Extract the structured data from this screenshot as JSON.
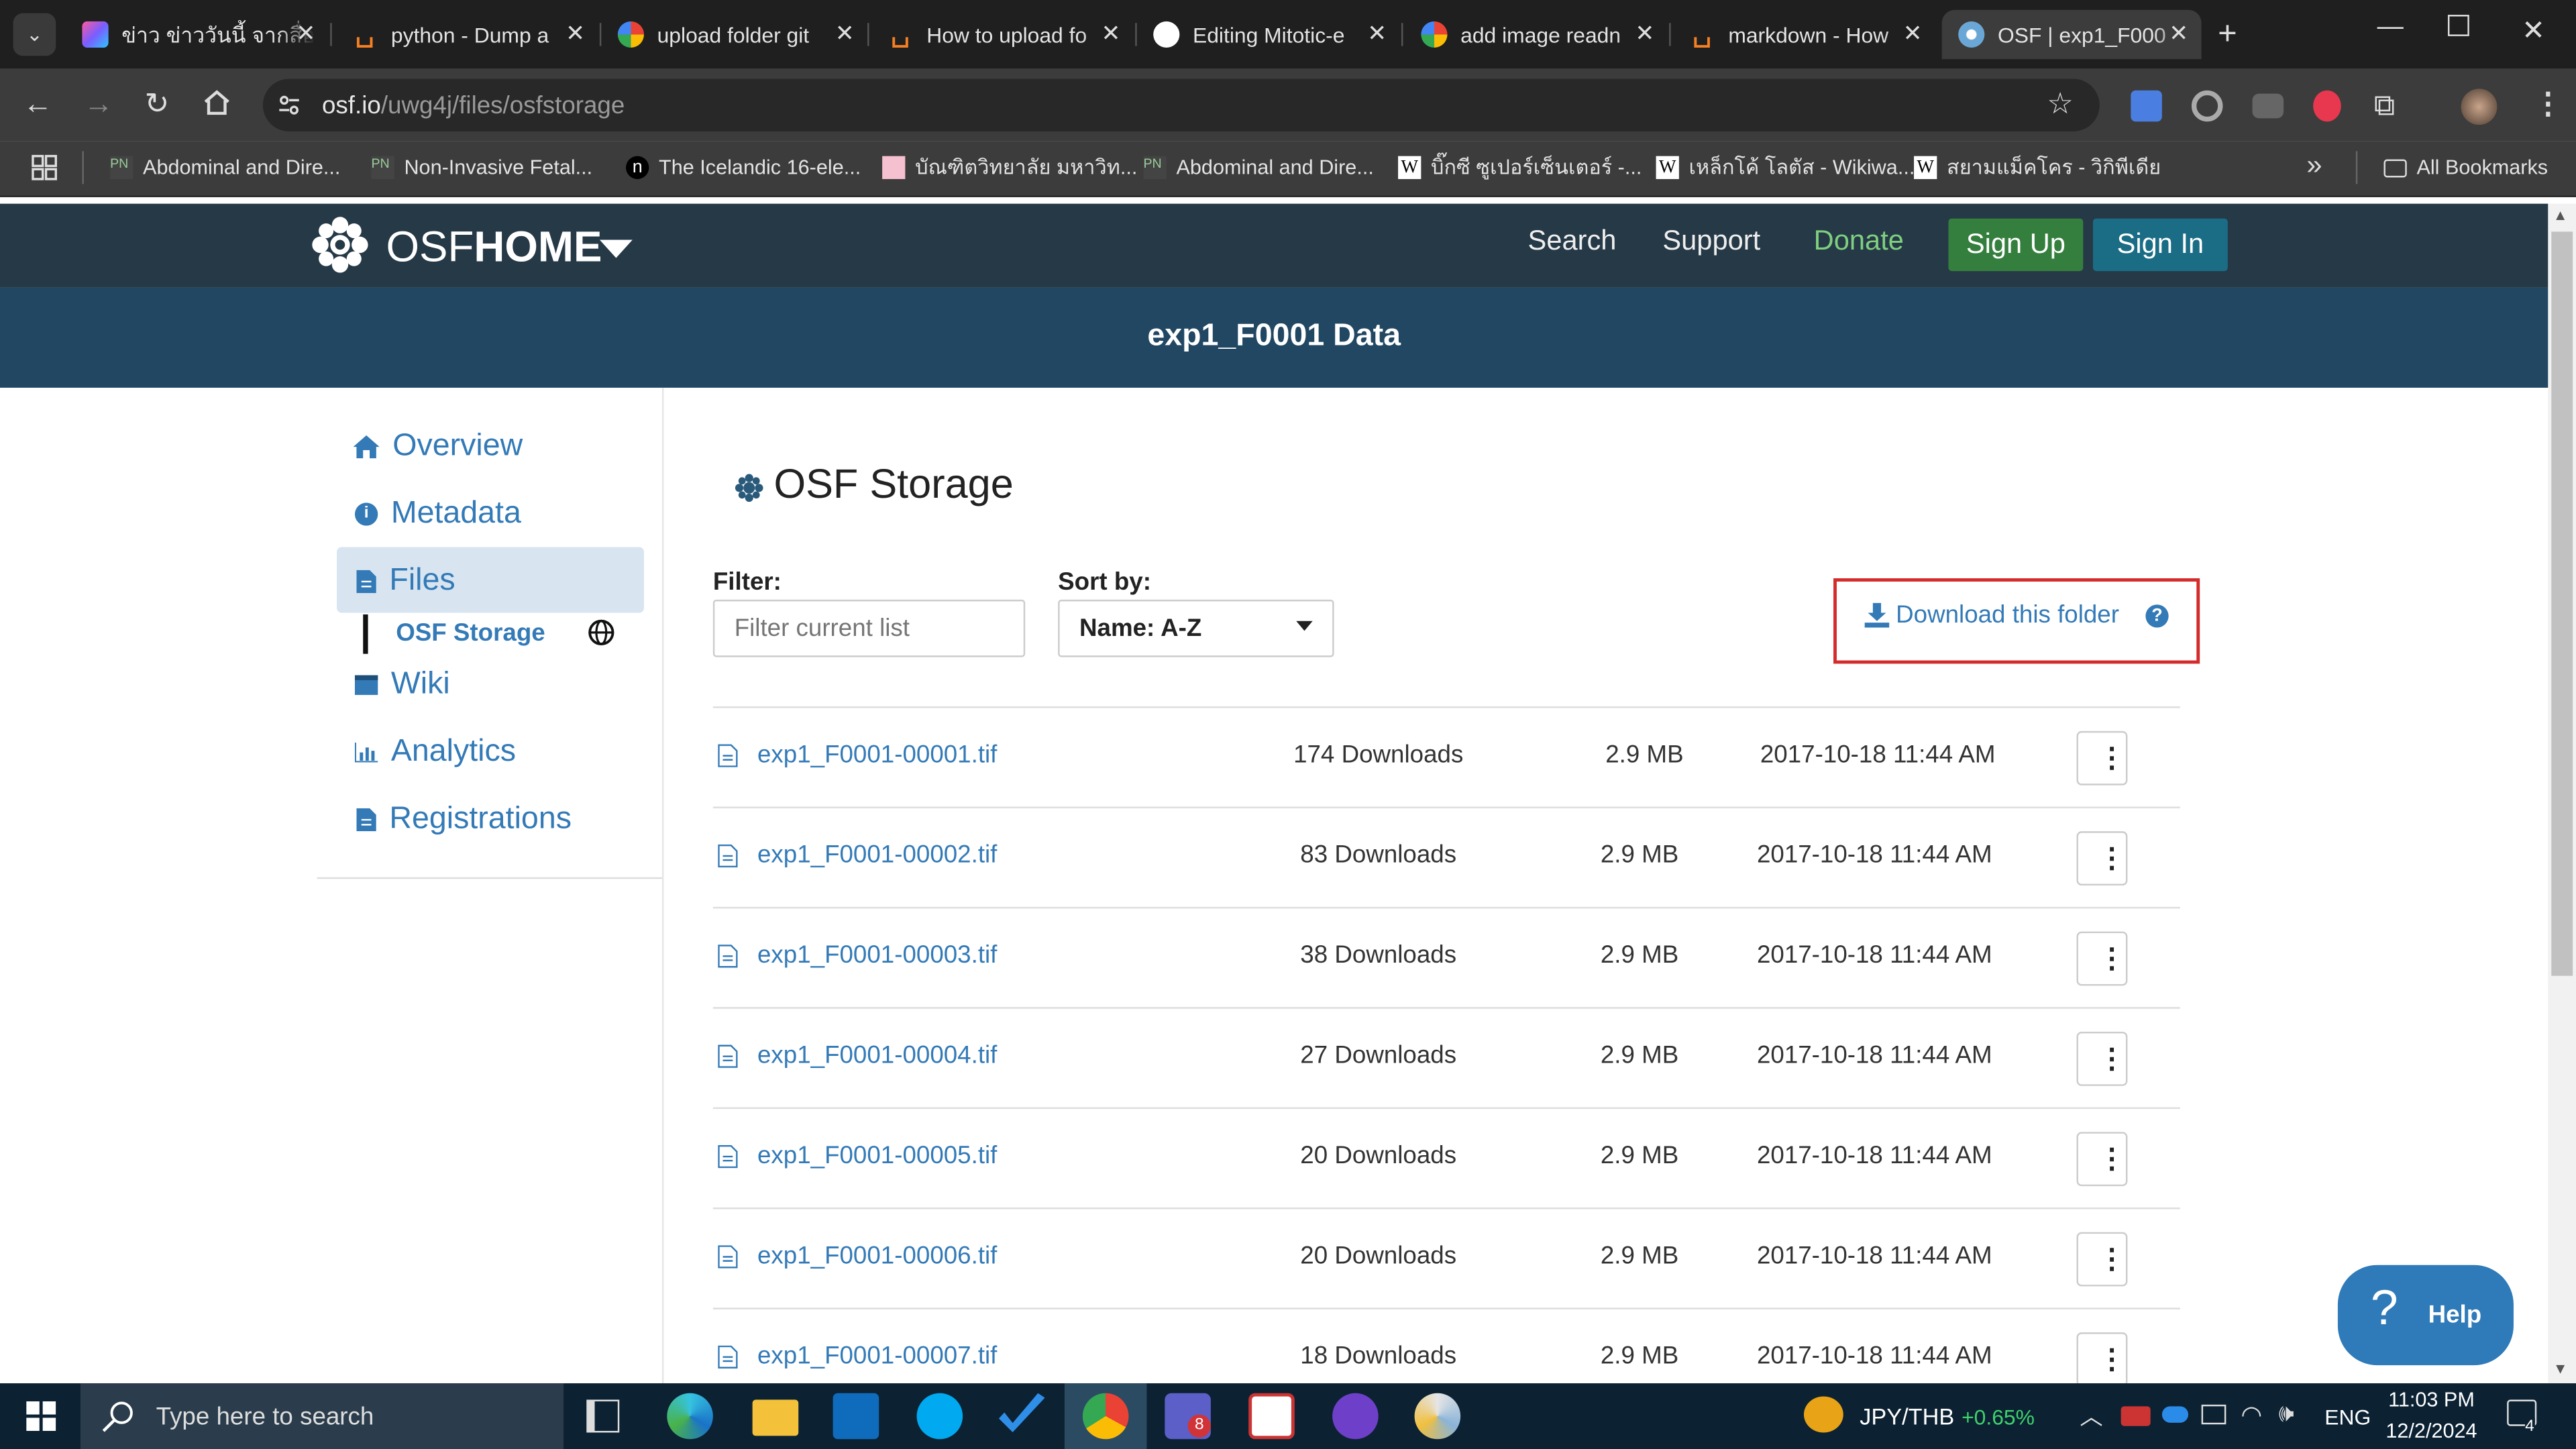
{
  "browser": {
    "tabs": [
      {
        "title": "ข่าว ข่าววันนี้ จากสื่อ",
        "color": "#7b5cff"
      },
      {
        "title": "python - Dump a",
        "color": "#f48024"
      },
      {
        "title": "upload folder git",
        "color": "#4285f4"
      },
      {
        "title": "How to upload fo",
        "color": "#f48024"
      },
      {
        "title": "Editing Mitotic-e",
        "color": "#ffffff"
      },
      {
        "title": "add image readn",
        "color": "#4285f4"
      },
      {
        "title": "markdown - How",
        "color": "#f48024"
      },
      {
        "title": "OSF | exp1_F000",
        "color": "#6aa7d6"
      }
    ],
    "url_host": "osf.io",
    "url_path": "/uwg4j/files/osfstorage",
    "bookmarks": [
      {
        "label": "Abdominal and Dire...",
        "icon": "pn-icon"
      },
      {
        "label": "Non-Invasive Fetal...",
        "icon": "pn-icon"
      },
      {
        "label": "The Icelandic 16-ele...",
        "icon": "n-icon"
      },
      {
        "label": "บัณฑิตวิทยาลัย มหาวิท...",
        "icon": "uni-icon"
      },
      {
        "label": "Abdominal and Dire...",
        "icon": "pn-icon"
      },
      {
        "label": "บิ๊กซี ซูเปอร์เซ็นเตอร์ -...",
        "icon": "w-icon"
      },
      {
        "label": "เหล็กโค้ โลตัส - Wikiwa...",
        "icon": "w-icon"
      },
      {
        "label": "สยามแม็คโคร - วิกิพีเดีย",
        "icon": "w-icon"
      }
    ],
    "all_bookmarks": "All Bookmarks",
    "more": "»"
  },
  "osf": {
    "brand_light": "OSF",
    "brand_bold": "HOME",
    "nav": {
      "search": "Search",
      "support": "Support",
      "donate": "Donate",
      "signup": "Sign Up",
      "signin": "Sign In"
    },
    "project_title": "exp1_F0001 Data",
    "sidebar": [
      {
        "label": "Overview",
        "icon": "home-icon"
      },
      {
        "label": "Metadata",
        "icon": "info-icon"
      },
      {
        "label": "Files",
        "icon": "file-icon"
      },
      {
        "label": "OSF Storage",
        "icon": "globe-icon"
      },
      {
        "label": "Wiki",
        "icon": "wiki-icon"
      },
      {
        "label": "Analytics",
        "icon": "chart-icon"
      },
      {
        "label": "Registrations",
        "icon": "file-icon"
      }
    ],
    "storage_title": "OSF Storage",
    "filter_label": "Filter:",
    "filter_placeholder": "Filter current list",
    "sort_label": "Sort by:",
    "sort_value": "Name: A-Z",
    "download_folder": "Download this folder",
    "files": [
      {
        "name": "exp1_F0001-00001.tif",
        "downloads": "174 Downloads",
        "size": "2.9 MB",
        "date": "2017-10-18 11:44 AM"
      },
      {
        "name": "exp1_F0001-00002.tif",
        "downloads": "83 Downloads",
        "size": "2.9 MB",
        "date": "2017-10-18 11:44 AM"
      },
      {
        "name": "exp1_F0001-00003.tif",
        "downloads": "38 Downloads",
        "size": "2.9 MB",
        "date": "2017-10-18 11:44 AM"
      },
      {
        "name": "exp1_F0001-00004.tif",
        "downloads": "27 Downloads",
        "size": "2.9 MB",
        "date": "2017-10-18 11:44 AM"
      },
      {
        "name": "exp1_F0001-00005.tif",
        "downloads": "20 Downloads",
        "size": "2.9 MB",
        "date": "2017-10-18 11:44 AM"
      },
      {
        "name": "exp1_F0001-00006.tif",
        "downloads": "20 Downloads",
        "size": "2.9 MB",
        "date": "2017-10-18 11:44 AM"
      },
      {
        "name": "exp1_F0001-00007.tif",
        "downloads": "18 Downloads",
        "size": "2.9 MB",
        "date": "2017-10-18 11:44 AM"
      }
    ],
    "help": "Help"
  },
  "taskbar": {
    "search_placeholder": "Type here to search",
    "ticker_symbol": "JPY/THB",
    "ticker_change": "+0.65%",
    "lang": "ENG",
    "time": "11:03 PM",
    "date": "12/2/2024",
    "notif_count": "4",
    "teams_badge": "8"
  },
  "colors": {
    "osf_header": "#263947",
    "osf_banner": "#214762",
    "link": "#337ab7",
    "signup": "#357f3e",
    "signin": "#1b6d85",
    "donate": "#7fcf7f",
    "highlight": "#d9534f"
  }
}
